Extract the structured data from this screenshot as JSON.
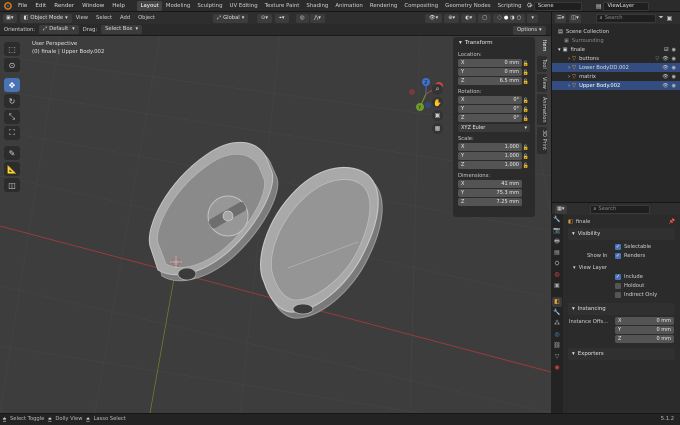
{
  "menu": [
    "File",
    "Edit",
    "Render",
    "Window",
    "Help"
  ],
  "workspaces": [
    "Layout",
    "Modeling",
    "Sculpting",
    "UV Editing",
    "Texture Paint",
    "Shading",
    "Animation",
    "Rendering",
    "Compositing",
    "Geometry Nodes",
    "Scripting",
    "+"
  ],
  "active_workspace": "Layout",
  "scene": "Scene",
  "view_layer": "ViewLayer",
  "viewport_header": {
    "mode": "Object Mode",
    "menus": [
      "View",
      "Select",
      "Add",
      "Object"
    ],
    "transform_orientation": "Global"
  },
  "tool_settings": {
    "orientation_label": "Orientation:",
    "orientation_value": "Default",
    "drag_label": "Drag:",
    "drag_value": "Select Box",
    "options": "Options"
  },
  "viewport": {
    "view_name": "User Perspective",
    "object_info": "(0) finale | Upper Body.002",
    "gizmo_labels": [
      "X",
      "Y",
      "Z"
    ]
  },
  "npanel": {
    "title": "Transform",
    "location_label": "Location:",
    "location": [
      {
        "axis": "X",
        "value": "0 mm"
      },
      {
        "axis": "Y",
        "value": "0 mm"
      },
      {
        "axis": "Z",
        "value": "6.5 mm"
      }
    ],
    "rotation_label": "Rotation:",
    "rotation": [
      {
        "axis": "X",
        "value": "0°"
      },
      {
        "axis": "Y",
        "value": "0°"
      },
      {
        "axis": "Z",
        "value": "0°"
      }
    ],
    "rotation_mode": "XYZ Euler",
    "scale_label": "Scale:",
    "scale": [
      {
        "axis": "X",
        "value": "1.000"
      },
      {
        "axis": "Y",
        "value": "1.000"
      },
      {
        "axis": "Z",
        "value": "1.000"
      }
    ],
    "dimensions_label": "Dimensions:",
    "dimensions": [
      {
        "axis": "X",
        "value": "41 mm"
      },
      {
        "axis": "Y",
        "value": "75.3 mm"
      },
      {
        "axis": "Z",
        "value": "7.25 mm"
      }
    ],
    "tabs": [
      "Item",
      "Tool",
      "View",
      "Animation",
      "3D Print"
    ]
  },
  "outliner": {
    "search_placeholder": "Search",
    "root": "Scene Collection",
    "rows": [
      {
        "name": "Surrounding",
        "indent": 1,
        "selected": false
      },
      {
        "name": "finale",
        "indent": 1,
        "selected": false
      },
      {
        "name": "buttons",
        "indent": 2,
        "selected": false
      },
      {
        "name": "Lower BodyDD.002",
        "indent": 2,
        "selected": true
      },
      {
        "name": "matrix",
        "indent": 2,
        "selected": false
      },
      {
        "name": "Upper Body.002",
        "indent": 2,
        "selected": true
      }
    ]
  },
  "properties": {
    "search_placeholder": "Search",
    "object_name": "finale",
    "visibility_label": "Visibility",
    "selectable": "Selectable",
    "show_in_label": "Show In",
    "renders": "Renders",
    "view_layer_label": "View Layer",
    "include": "Include",
    "holdout": "Holdout",
    "indirect_only": "Indirect Only",
    "instancing_label": "Instancing",
    "instance_offset_label": "Instance Offs...",
    "instance_offset": [
      {
        "axis": "X",
        "value": "0 mm"
      },
      {
        "axis": "Y",
        "value": "0 mm"
      },
      {
        "axis": "Z",
        "value": "0 mm"
      }
    ],
    "exporters_label": "Exporters"
  },
  "status_bar": {
    "items": [
      "Select Toggle",
      "Dolly View",
      "Lasso Select"
    ],
    "version": "5.1.2"
  },
  "colors": {
    "accent": "#4772b3",
    "selected_row": "#334d80",
    "viewport_bg": "#3d3d3d"
  }
}
